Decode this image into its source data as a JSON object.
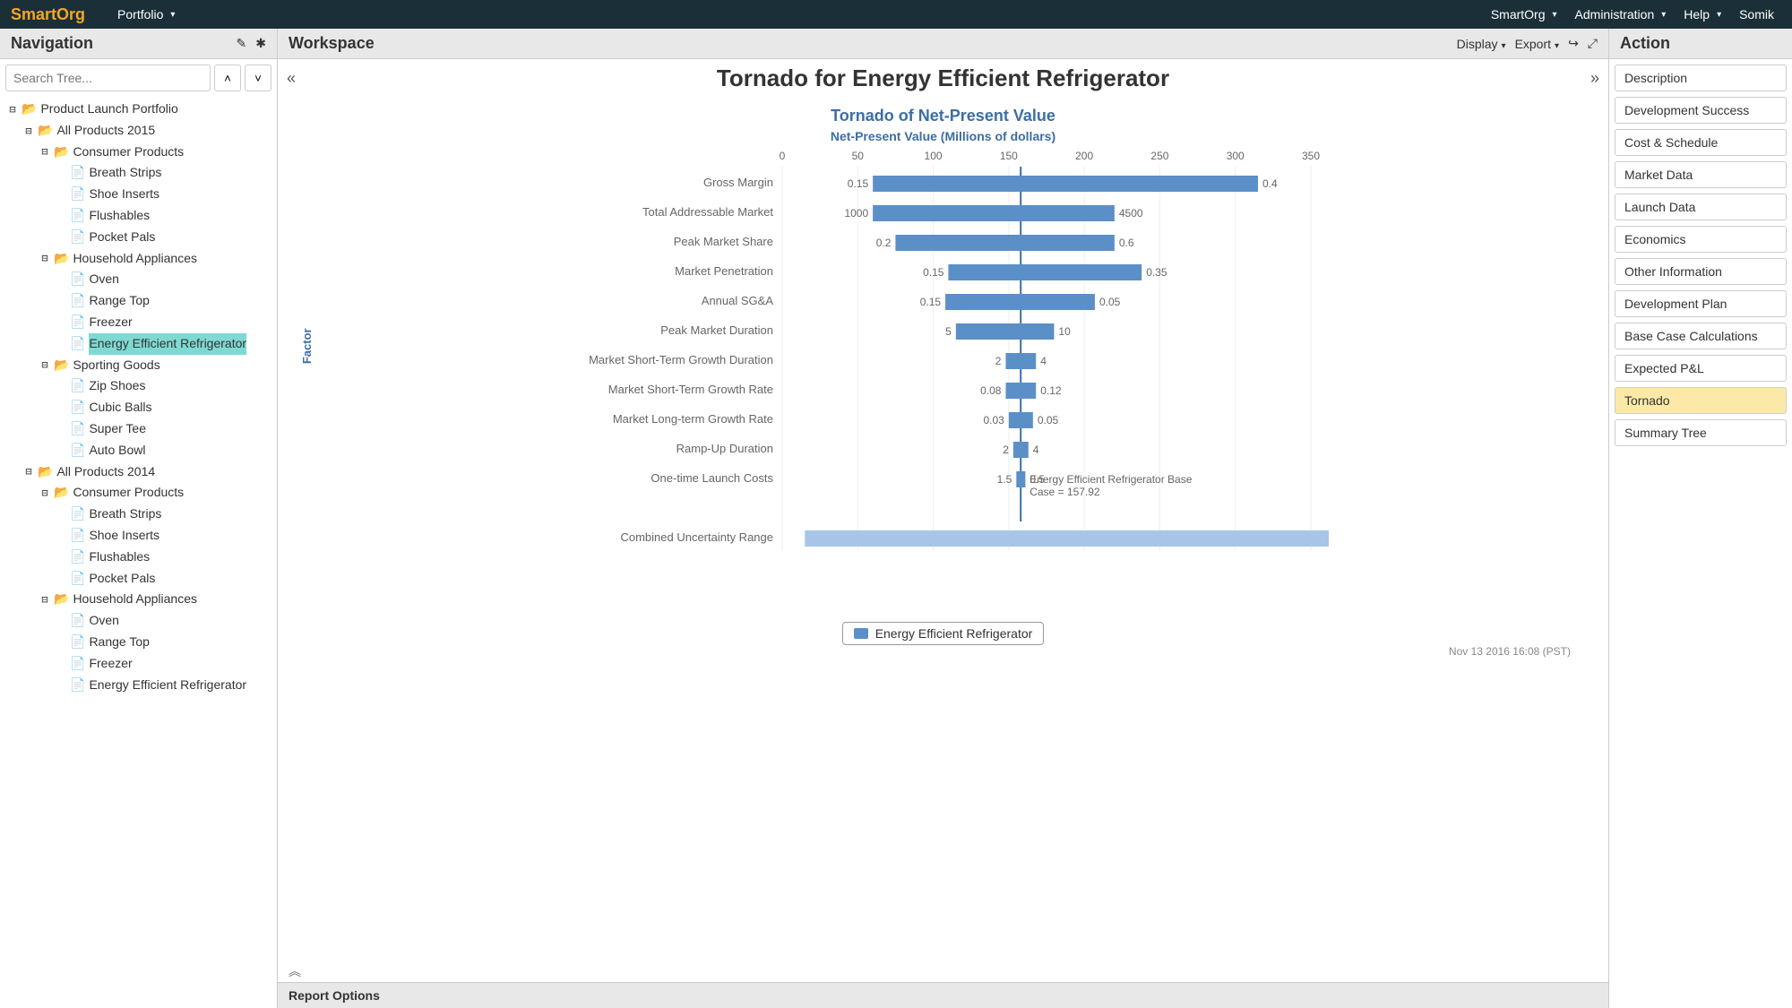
{
  "topbar": {
    "brand": "SmartOrg",
    "left": [
      "Portfolio"
    ],
    "right": [
      "SmartOrg",
      "Administration",
      "Help",
      "Somik"
    ]
  },
  "navigation": {
    "title": "Navigation",
    "search_placeholder": "Search Tree...",
    "tree": [
      {
        "indent": 0,
        "folder": true,
        "open": true,
        "label": "Product Launch Portfolio"
      },
      {
        "indent": 1,
        "folder": true,
        "open": true,
        "label": "All Products 2015"
      },
      {
        "indent": 2,
        "folder": true,
        "open": true,
        "label": "Consumer Products"
      },
      {
        "indent": 3,
        "folder": false,
        "label": "Breath Strips"
      },
      {
        "indent": 3,
        "folder": false,
        "label": "Shoe Inserts"
      },
      {
        "indent": 3,
        "folder": false,
        "label": "Flushables"
      },
      {
        "indent": 3,
        "folder": false,
        "label": "Pocket Pals"
      },
      {
        "indent": 2,
        "folder": true,
        "open": true,
        "label": "Household Appliances"
      },
      {
        "indent": 3,
        "folder": false,
        "label": "Oven"
      },
      {
        "indent": 3,
        "folder": false,
        "label": "Range Top"
      },
      {
        "indent": 3,
        "folder": false,
        "label": "Freezer"
      },
      {
        "indent": 3,
        "folder": false,
        "label": "Energy Efficient Refrigerator",
        "selected": true
      },
      {
        "indent": 2,
        "folder": true,
        "open": true,
        "label": "Sporting Goods"
      },
      {
        "indent": 3,
        "folder": false,
        "label": "Zip Shoes"
      },
      {
        "indent": 3,
        "folder": false,
        "label": "Cubic Balls"
      },
      {
        "indent": 3,
        "folder": false,
        "label": "Super Tee"
      },
      {
        "indent": 3,
        "folder": false,
        "label": "Auto Bowl"
      },
      {
        "indent": 1,
        "folder": true,
        "open": true,
        "label": "All Products 2014"
      },
      {
        "indent": 2,
        "folder": true,
        "open": true,
        "label": "Consumer Products"
      },
      {
        "indent": 3,
        "folder": false,
        "label": "Breath Strips"
      },
      {
        "indent": 3,
        "folder": false,
        "label": "Shoe Inserts"
      },
      {
        "indent": 3,
        "folder": false,
        "label": "Flushables"
      },
      {
        "indent": 3,
        "folder": false,
        "label": "Pocket Pals"
      },
      {
        "indent": 2,
        "folder": true,
        "open": true,
        "label": "Household Appliances"
      },
      {
        "indent": 3,
        "folder": false,
        "label": "Oven"
      },
      {
        "indent": 3,
        "folder": false,
        "label": "Range Top"
      },
      {
        "indent": 3,
        "folder": false,
        "label": "Freezer"
      },
      {
        "indent": 3,
        "folder": false,
        "label": "Energy Efficient Refrigerator"
      }
    ]
  },
  "workspace": {
    "title": "Workspace",
    "display_label": "Display",
    "export_label": "Export",
    "page_title": "Tornado for Energy Efficient Refrigerator",
    "timestamp": "Nov 13 2016 16:08 (PST)",
    "report_options": "Report Options"
  },
  "actions": {
    "title": "Action",
    "items": [
      {
        "label": "Description"
      },
      {
        "label": "Development Success"
      },
      {
        "label": "Cost & Schedule"
      },
      {
        "label": "Market Data"
      },
      {
        "label": "Launch Data"
      },
      {
        "label": "Economics"
      },
      {
        "label": "Other Information"
      },
      {
        "label": "Development Plan"
      },
      {
        "label": "Base Case Calculations"
      },
      {
        "label": "Expected P&L"
      },
      {
        "label": "Tornado",
        "active": true
      },
      {
        "label": "Summary Tree"
      }
    ]
  },
  "chart_data": {
    "type": "bar",
    "title": "Tornado of Net-Present Value",
    "subtitle": "Net-Present Value (Millions of dollars)",
    "ylabel": "Factor",
    "xlim": [
      0,
      350
    ],
    "xticks": [
      0,
      50,
      100,
      150,
      200,
      250,
      300,
      350
    ],
    "base_case": 157.92,
    "base_case_label": "Energy Efficient Refrigerator Base Case = 157.92",
    "legend": "Energy Efficient Refrigerator",
    "factors": [
      {
        "name": "Gross Margin",
        "low_label": "0.15",
        "high_label": "0.4",
        "low_npv": 60,
        "high_npv": 315
      },
      {
        "name": "Total Addressable Market",
        "low_label": "1000",
        "high_label": "4500",
        "low_npv": 60,
        "high_npv": 220
      },
      {
        "name": "Peak Market Share",
        "low_label": "0.2",
        "high_label": "0.6",
        "low_npv": 75,
        "high_npv": 220
      },
      {
        "name": "Market Penetration",
        "low_label": "0.15",
        "high_label": "0.35",
        "low_npv": 110,
        "high_npv": 238
      },
      {
        "name": "Annual SG&A",
        "low_label": "0.15",
        "high_label": "0.05",
        "low_npv": 108,
        "high_npv": 207
      },
      {
        "name": "Peak Market Duration",
        "low_label": "5",
        "high_label": "10",
        "low_npv": 115,
        "high_npv": 180
      },
      {
        "name": "Market Short-Term Growth Duration",
        "low_label": "2",
        "high_label": "4",
        "low_npv": 148,
        "high_npv": 168
      },
      {
        "name": "Market Short-Term Growth Rate",
        "low_label": "0.08",
        "high_label": "0.12",
        "low_npv": 148,
        "high_npv": 168
      },
      {
        "name": "Market Long-term Growth Rate",
        "low_label": "0.03",
        "high_label": "0.05",
        "low_npv": 150,
        "high_npv": 166
      },
      {
        "name": "Ramp-Up Duration",
        "low_label": "2",
        "high_label": "4",
        "low_npv": 153,
        "high_npv": 163
      },
      {
        "name": "One-time Launch Costs",
        "low_label": "1.5",
        "high_label": "0.5",
        "low_npv": 155,
        "high_npv": 161
      }
    ],
    "combined_uncertainty": {
      "name": "Combined Uncertainty Range",
      "low_npv": 15,
      "high_npv": 365
    }
  }
}
